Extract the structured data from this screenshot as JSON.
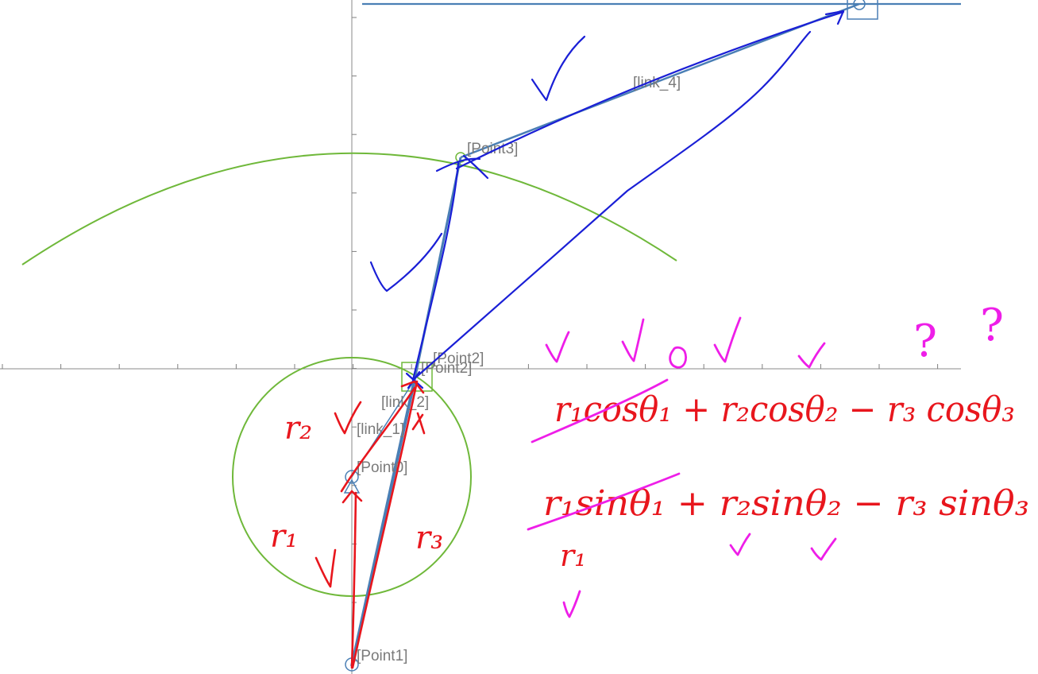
{
  "labels": {
    "point0": "[Point0]",
    "point1": "[Point1]",
    "point2a": "[Point2]",
    "point2b": "[Point2]",
    "point3": "[Point3]",
    "link1": "[link_1]",
    "link2": "[link_2]",
    "link4": "[link_4]"
  },
  "annotations": {
    "eq1": "r₁cosθ₁ + r₂cosθ₂ − r₃ cosθ₃",
    "eq2": "r₁sinθ₁ + r₂sinθ₂ − r₃ sinθ₃",
    "r1_circle": "r₁",
    "r2_circle": "r₂",
    "r3_circle": "r₃",
    "r1_below": "r₁",
    "q1": "?",
    "q2": "?"
  },
  "colors": {
    "axis": "#7f7f7f",
    "mechanism": "#4a7fb5",
    "circle": "#6fb83a",
    "ink_red": "#e8161d",
    "ink_blue": "#1a1fd6",
    "ink_magenta": "#ee1ee8"
  }
}
